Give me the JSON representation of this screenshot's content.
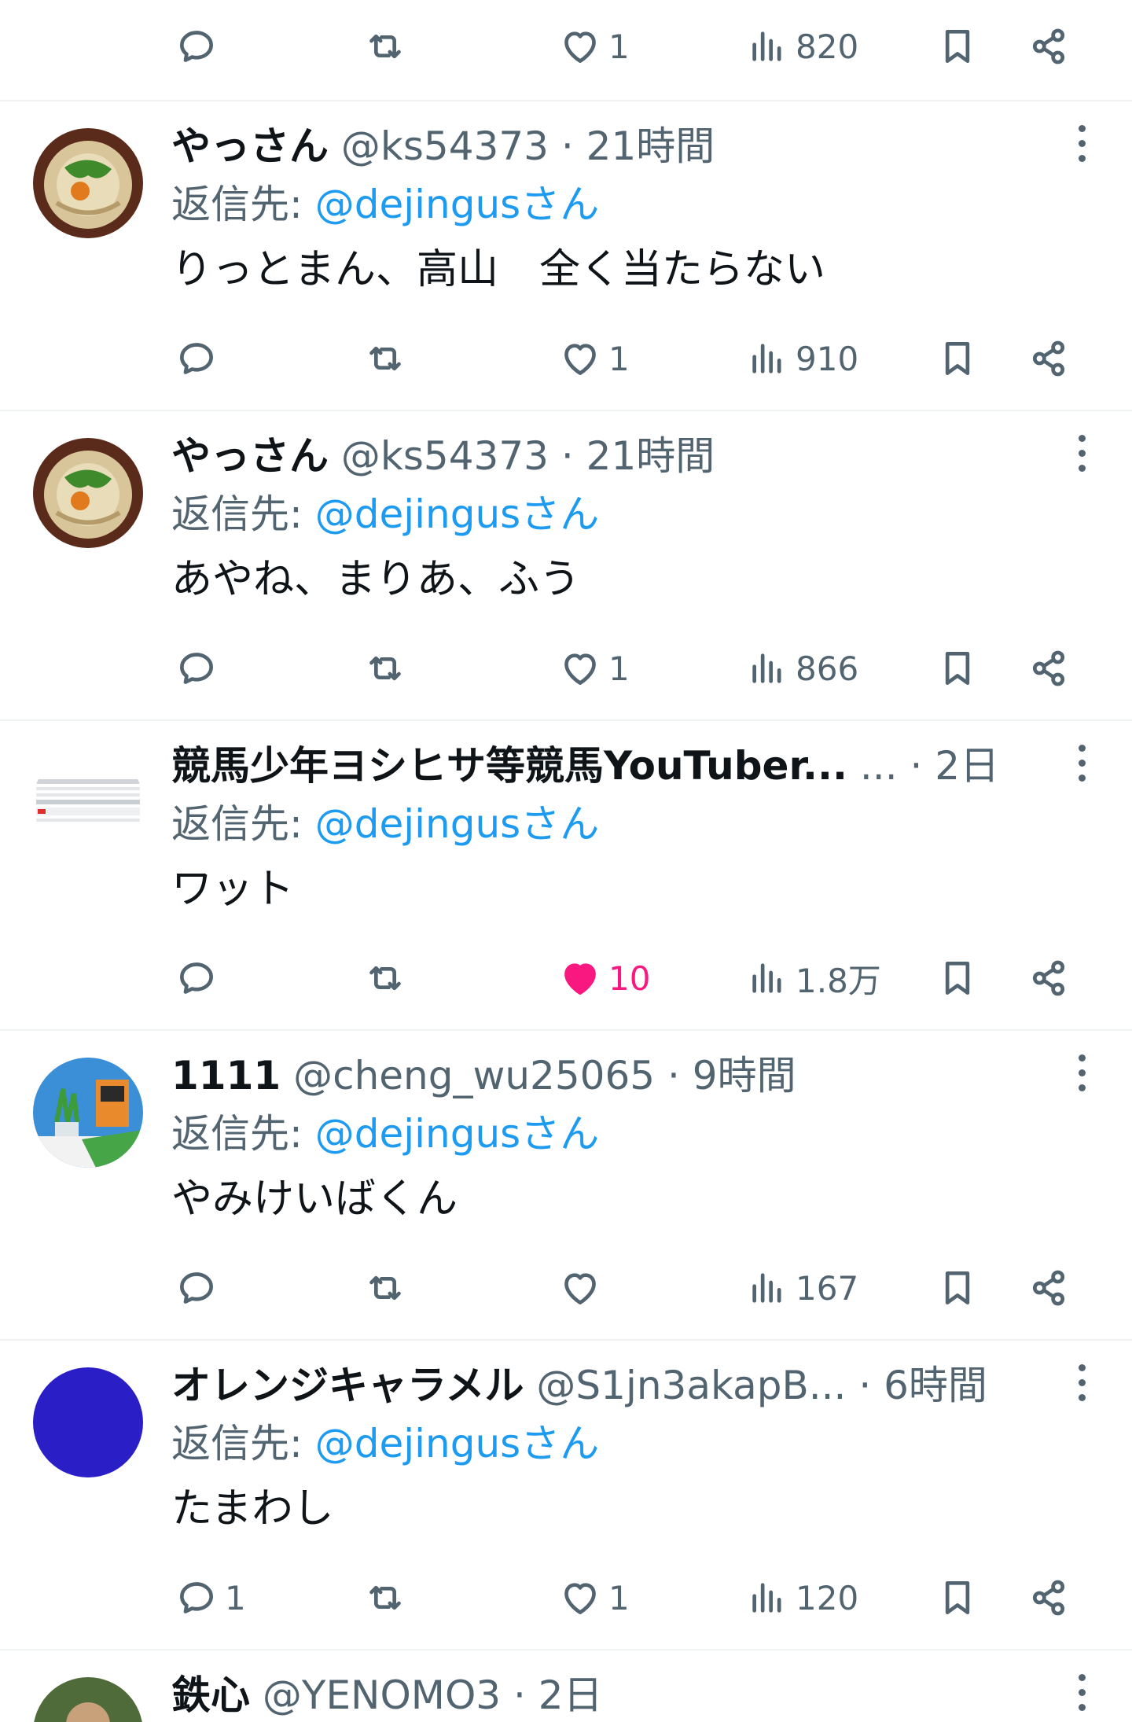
{
  "colors": {
    "accent": "#1d9bf0",
    "like": "#f91880",
    "muted": "#536471",
    "text": "#0f1419",
    "divider": "#eff3f4"
  },
  "top_actions": {
    "reply": "",
    "retweet": "",
    "likes": "1",
    "views": "820"
  },
  "posts": [
    {
      "name": "やっさん",
      "handle": "@ks54373",
      "sep": " · ",
      "time": "21時間",
      "reply_prefix": "返信先: ",
      "reply_to": "@dejingusさん",
      "text": "りっとまん、高山　全く当たらない",
      "replies": "",
      "retweets": "",
      "likes": "1",
      "liked": false,
      "views": "910",
      "avatar": "udon-bowl"
    },
    {
      "name": "やっさん",
      "handle": "@ks54373",
      "sep": " · ",
      "time": "21時間",
      "reply_prefix": "返信先: ",
      "reply_to": "@dejingusさん",
      "text": "あやね、まりあ、ふう",
      "replies": "",
      "retweets": "",
      "likes": "1",
      "liked": false,
      "views": "866",
      "avatar": "udon-bowl"
    },
    {
      "name": "競馬少年ヨシヒサ等競馬YouTuber...",
      "handle": "...",
      "sep": " · ",
      "time": "2日",
      "reply_prefix": "返信先: ",
      "reply_to": "@dejingusさん",
      "text": "ワット",
      "replies": "",
      "retweets": "",
      "likes": "10",
      "liked": true,
      "views": "1.8万",
      "avatar": "betting-slip"
    },
    {
      "name": "1111",
      "handle": "@cheng_wu25065",
      "sep": " · ",
      "time": "9時間",
      "reply_prefix": "返信先: ",
      "reply_to": "@dejingusさん",
      "text": "やみけいばくん",
      "replies": "",
      "retweets": "",
      "likes": "",
      "liked": false,
      "views": "167",
      "avatar": "desk-illustration"
    },
    {
      "name": "オレンジキャラメル",
      "handle": "@S1jn3akapB...",
      "sep": " · ",
      "time": "6時間",
      "reply_prefix": "返信先: ",
      "reply_to": "@dejingusさん",
      "text": "たまわし",
      "replies": "1",
      "retweets": "",
      "likes": "1",
      "liked": false,
      "views": "120",
      "avatar": "blue-circle"
    },
    {
      "name": "鉄心",
      "handle": "@YENOMO3",
      "sep": " · ",
      "time": "2日",
      "avatar": "photo-person"
    }
  ]
}
